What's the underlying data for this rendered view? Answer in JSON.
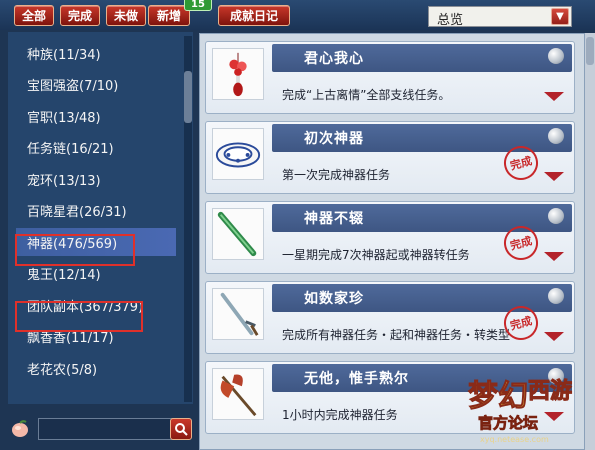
{
  "toolbar": {
    "all": "全部",
    "done": "完成",
    "undone": "未做",
    "new": "新增",
    "new_count": "15",
    "diary": "成就日记"
  },
  "filter": {
    "selected": "总览"
  },
  "sidebar": {
    "items": [
      {
        "label": "种族(11/34)"
      },
      {
        "label": "宝图强盗(7/10)"
      },
      {
        "label": "官职(13/48)"
      },
      {
        "label": "任务链(16/21)"
      },
      {
        "label": "宠环(13/13)"
      },
      {
        "label": "百晓星君(26/31)"
      },
      {
        "label": "神器(476/569)",
        "selected": true
      },
      {
        "label": "鬼王(12/14)"
      },
      {
        "label": "团队副本(367/379)"
      },
      {
        "label": "飘香香(11/17)"
      },
      {
        "label": "老花农(5/8)"
      }
    ]
  },
  "search": {
    "value": ""
  },
  "achievements": [
    {
      "title": "君心我心",
      "desc": "完成“上古离情”全部支线任务。",
      "completed": false,
      "icon": "ornament-icon"
    },
    {
      "title": "初次神器",
      "desc": "第一次完成神器任务",
      "completed": true,
      "icon": "bowl-icon"
    },
    {
      "title": "神器不辍",
      "desc": "一星期完成7次神器起或神器转任务",
      "completed": true,
      "icon": "jade-sword-icon"
    },
    {
      "title": "如数家珍",
      "desc": "完成所有神器任务・起和神器任务・转类型",
      "completed": true,
      "icon": "sword-icon"
    },
    {
      "title": "无他，惟手熟尔",
      "desc": "1小时内完成神器任务",
      "completed": false,
      "icon": "axe-icon"
    }
  ],
  "stamp_text": "完成",
  "watermark": {
    "text1": "官方论坛",
    "text2": "xyq.netease.com"
  },
  "colors": {
    "accent_red": "#c9382a",
    "selected_bg": "#4a69b3",
    "panel_bg": "#25456c"
  }
}
